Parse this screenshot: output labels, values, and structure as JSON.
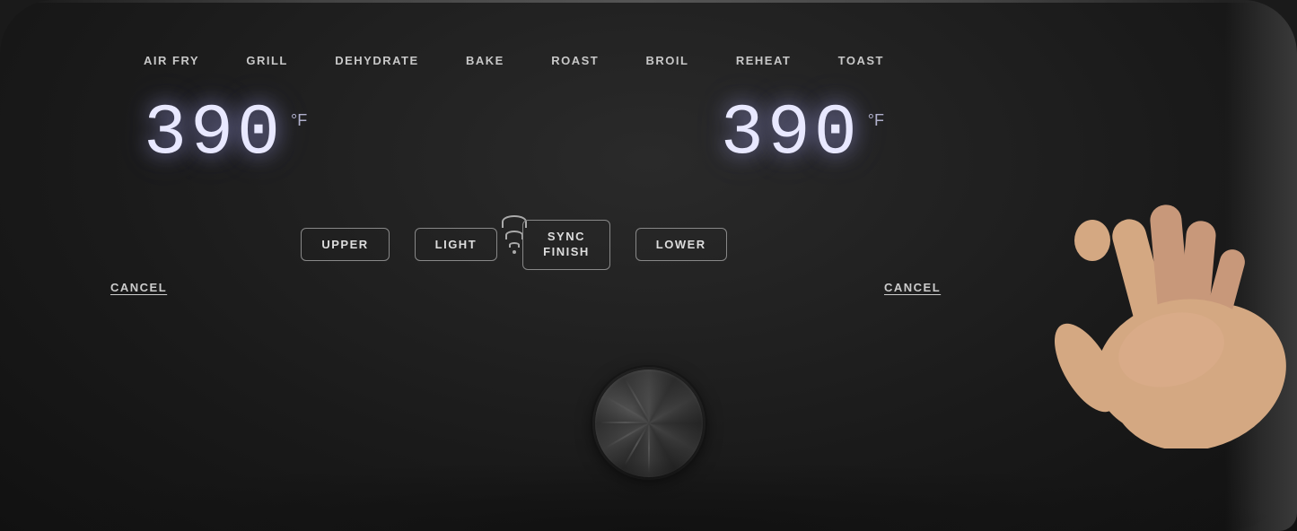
{
  "panel": {
    "backgroundColor": "#1a1a1a"
  },
  "modeLabels": {
    "items": [
      {
        "id": "air-fry",
        "label": "AIR FRY"
      },
      {
        "id": "grill",
        "label": "GRILL"
      },
      {
        "id": "dehydrate",
        "label": "DEHYDRATE"
      },
      {
        "id": "bake",
        "label": "BAKE"
      },
      {
        "id": "roast",
        "label": "ROAST"
      },
      {
        "id": "broil",
        "label": "BROIL"
      },
      {
        "id": "reheat",
        "label": "REHEAT"
      },
      {
        "id": "toast",
        "label": "TOAST"
      }
    ]
  },
  "upperDisplay": {
    "temperature": "390",
    "unit": "°F"
  },
  "lowerDisplay": {
    "temperature": "390",
    "unit": "°F"
  },
  "controlButtons": {
    "upper": {
      "label": "UPPER"
    },
    "light": {
      "label": "LIGHT"
    },
    "syncFinish": {
      "label": "SYNC\nFINISH"
    },
    "lower": {
      "label": "LOWER"
    }
  },
  "cancelLeft": {
    "label": "CANCEL"
  },
  "cancelRight": {
    "label": "CANCEL"
  }
}
